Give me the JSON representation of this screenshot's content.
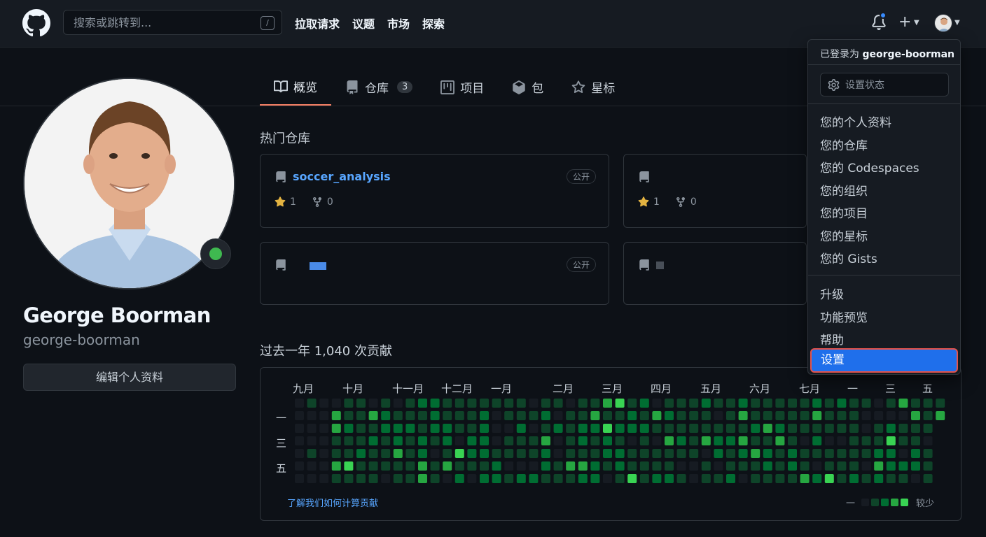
{
  "header": {
    "search_placeholder": "搜索或跳转到...",
    "search_hint": "/",
    "nav": [
      "拉取请求",
      "议题",
      "市场",
      "探索"
    ]
  },
  "tabs": [
    {
      "label": "概览",
      "icon": "book-icon",
      "active": true
    },
    {
      "label": "仓库",
      "icon": "repo-icon",
      "count": "3"
    },
    {
      "label": "项目",
      "icon": "project-icon"
    },
    {
      "label": "包",
      "icon": "package-icon"
    },
    {
      "label": "星标",
      "icon": "star-icon"
    }
  ],
  "profile": {
    "name": "George Boorman",
    "login": "george-boorman",
    "edit_label": "编辑个人资料"
  },
  "popular": {
    "title": "热门仓库",
    "cards": [
      {
        "name": "soccer_analysis",
        "visibility": "公开",
        "stars": "1",
        "forks": "0"
      },
      {
        "name": "",
        "visibility": "",
        "stars": "1",
        "forks": "0"
      },
      {
        "name": "",
        "visibility": "公开",
        "stars": "",
        "forks": ""
      },
      {
        "name": "",
        "visibility": "",
        "stars": "",
        "forks": ""
      }
    ]
  },
  "contrib": {
    "title": "过去一年 1,040 次贡献",
    "months": [
      "九月",
      "十月",
      "十一月",
      "十二月",
      "一月",
      "二月",
      "三月",
      "四月",
      "五月",
      "六月",
      "七月",
      "一",
      "三",
      "五"
    ],
    "days": [
      "一",
      "三",
      "五"
    ],
    "learn_label": "了解我们如何计算贡献",
    "legend_less": "一",
    "legend_more": "较少",
    "colors": [
      "#161b22",
      "#0e4429",
      "#006d32",
      "#26a641",
      "#39d353"
    ]
  },
  "menu": {
    "signed_prefix": "已登录为",
    "signed_user": "george-boorman",
    "set_status": "设置状态",
    "group1": [
      "您的个人资料",
      "您的仓库",
      "您的 Codespaces",
      "您的组织",
      "您的项目",
      "您的星标",
      "您的 Gists"
    ],
    "group2": [
      "升级",
      "功能预览",
      "帮助"
    ],
    "settings": "设置"
  }
}
